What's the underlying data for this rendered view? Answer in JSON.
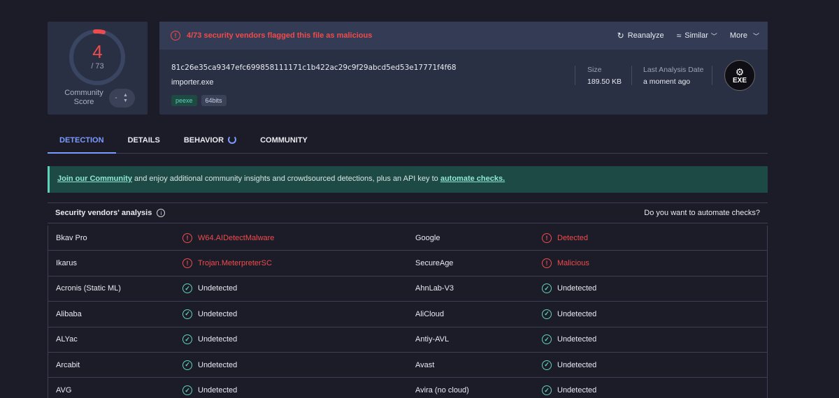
{
  "score": {
    "detections": "4",
    "total": "/ 73",
    "community_label": "Community\nScore",
    "community_value": "-"
  },
  "header": {
    "alert": "4/73 security vendors flagged this file as malicious",
    "actions": [
      {
        "label": "Reanalyze",
        "icon": "refresh-icon"
      },
      {
        "label": "Similar",
        "icon": "similar-icon"
      },
      {
        "label": "More",
        "icon": ""
      }
    ]
  },
  "file": {
    "hash": "81c26e35ca9347efc699858111171c1b422ac29c9f29abcd5ed53e17771f4f68",
    "name": "importer.exe",
    "tags": [
      "peexe",
      "64bits"
    ],
    "size_label": "Size",
    "size_value": "189.50 KB",
    "last_analysis_label": "Last Analysis Date",
    "last_analysis_value": "a moment ago",
    "type_badge": "EXE"
  },
  "tabs": [
    "DETECTION",
    "DETAILS",
    "BEHAVIOR",
    "COMMUNITY"
  ],
  "banner": {
    "link1": "Join our Community",
    "mid": " and enjoy additional community insights and crowdsourced detections, plus an API key to ",
    "link2": "automate checks."
  },
  "analysis": {
    "title": "Security vendors' analysis",
    "right": "Do you want to automate checks?",
    "rows": [
      {
        "v1": "Bkav Pro",
        "r1": "W64.AIDetectMalware",
        "s1": "bad",
        "v2": "Google",
        "r2": "Detected",
        "s2": "bad"
      },
      {
        "v1": "Ikarus",
        "r1": "Trojan.MeterpreterSC",
        "s1": "bad",
        "v2": "SecureAge",
        "r2": "Malicious",
        "s2": "bad"
      },
      {
        "v1": "Acronis (Static ML)",
        "r1": "Undetected",
        "s1": "ok",
        "v2": "AhnLab-V3",
        "r2": "Undetected",
        "s2": "ok"
      },
      {
        "v1": "Alibaba",
        "r1": "Undetected",
        "s1": "ok",
        "v2": "AliCloud",
        "r2": "Undetected",
        "s2": "ok"
      },
      {
        "v1": "ALYac",
        "r1": "Undetected",
        "s1": "ok",
        "v2": "Antiy-AVL",
        "r2": "Undetected",
        "s2": "ok"
      },
      {
        "v1": "Arcabit",
        "r1": "Undetected",
        "s1": "ok",
        "v2": "Avast",
        "r2": "Undetected",
        "s2": "ok"
      },
      {
        "v1": "AVG",
        "r1": "Undetected",
        "s1": "ok",
        "v2": "Avira (no cloud)",
        "r2": "Undetected",
        "s2": "ok"
      }
    ]
  },
  "colors": {
    "malicious": "#ee4c4c",
    "clean": "#5fd3b8",
    "accent": "#7c9bff"
  }
}
